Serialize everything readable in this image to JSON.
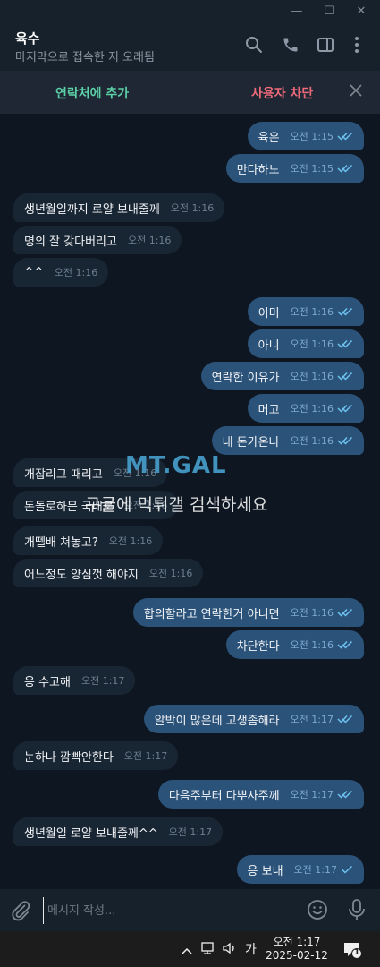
{
  "window": {
    "minimize_glyph": "—",
    "maximize_glyph": "☐",
    "close_glyph": "✕"
  },
  "header": {
    "title": "육수",
    "subtitle": "마지막으로 접속한 지 오래됨"
  },
  "action_bar": {
    "add_contact": "연락처에 추가",
    "block_user": "사용자 차단"
  },
  "messages": [
    {
      "text": "육은",
      "time": "오전 1:15",
      "dir": "out",
      "read": true
    },
    {
      "text": "만다하노",
      "time": "오전 1:15",
      "dir": "out",
      "read": true
    },
    {
      "text": "생년월일까지 로얄 보내줄께",
      "time": "오전 1:16",
      "dir": "in"
    },
    {
      "text": "명의 잘 갖다버리고",
      "time": "오전 1:16",
      "dir": "in"
    },
    {
      "text": "^^",
      "time": "오전 1:16",
      "dir": "in"
    },
    {
      "text": "이미",
      "time": "오전 1:16",
      "dir": "out",
      "read": true
    },
    {
      "text": "아니",
      "time": "오전 1:16",
      "dir": "out",
      "read": true
    },
    {
      "text": "연락한 이유가",
      "time": "오전 1:16",
      "dir": "out",
      "read": true
    },
    {
      "text": "머고",
      "time": "오전 1:16",
      "dir": "out",
      "read": true
    },
    {
      "text": "내 돈가온나",
      "time": "오전 1:16",
      "dir": "out",
      "read": true
    },
    {
      "text": "개잡리그 때리고",
      "time": "오전 1:16",
      "dir": "in"
    },
    {
      "text": "돈돌로하믄 국내로",
      "time": "오전 1:16",
      "dir": "in"
    },
    {
      "text": "개뗄배 쳐놓고?",
      "time": "오전 1:16",
      "dir": "in"
    },
    {
      "text": "어느정도 양심껏 해야지",
      "time": "오전 1:16",
      "dir": "in"
    },
    {
      "text": "합의할라고 연락한거 아니면",
      "time": "오전 1:16",
      "dir": "out",
      "read": true
    },
    {
      "text": "차단한다",
      "time": "오전 1:16",
      "dir": "out",
      "read": true
    },
    {
      "text": "응 수고해",
      "time": "오전 1:17",
      "dir": "in"
    },
    {
      "text": "알박이 많은데 고생좀해라",
      "time": "오전 1:17",
      "dir": "out",
      "read": true
    },
    {
      "text": "눈하나 깜빡안한다",
      "time": "오전 1:17",
      "dir": "in"
    },
    {
      "text": "다음주부터 다뿌사주께",
      "time": "오전 1:17",
      "dir": "out",
      "read": true
    },
    {
      "text": "생년월일 로얄 보내줄께^^",
      "time": "오전 1:17",
      "dir": "in"
    },
    {
      "text": "응 보내",
      "time": "오전 1:17",
      "dir": "out",
      "read": false
    }
  ],
  "watermark": {
    "logo": "MT.GAL",
    "text": "구글에 먹튀갤 검색하세요"
  },
  "composer": {
    "placeholder": "메시지 작성..."
  },
  "taskbar": {
    "ime": "가",
    "time": "오전 1:17",
    "date": "2025-02-12",
    "notification_count": "1"
  },
  "colors": {
    "background": "#0e1621",
    "bubble_out": "#2b5278",
    "bubble_in": "#182533",
    "add_contact": "#5cd0a6",
    "block_user": "#ec6a7a"
  },
  "icons": [
    "search-icon",
    "phone-icon",
    "sidebar-icon",
    "more-icon",
    "close-icon",
    "paperclip-icon",
    "emoji-icon",
    "microphone-icon",
    "check-icon",
    "double-check-icon",
    "chevron-up-icon",
    "network-icon",
    "volume-icon",
    "notification-icon"
  ]
}
